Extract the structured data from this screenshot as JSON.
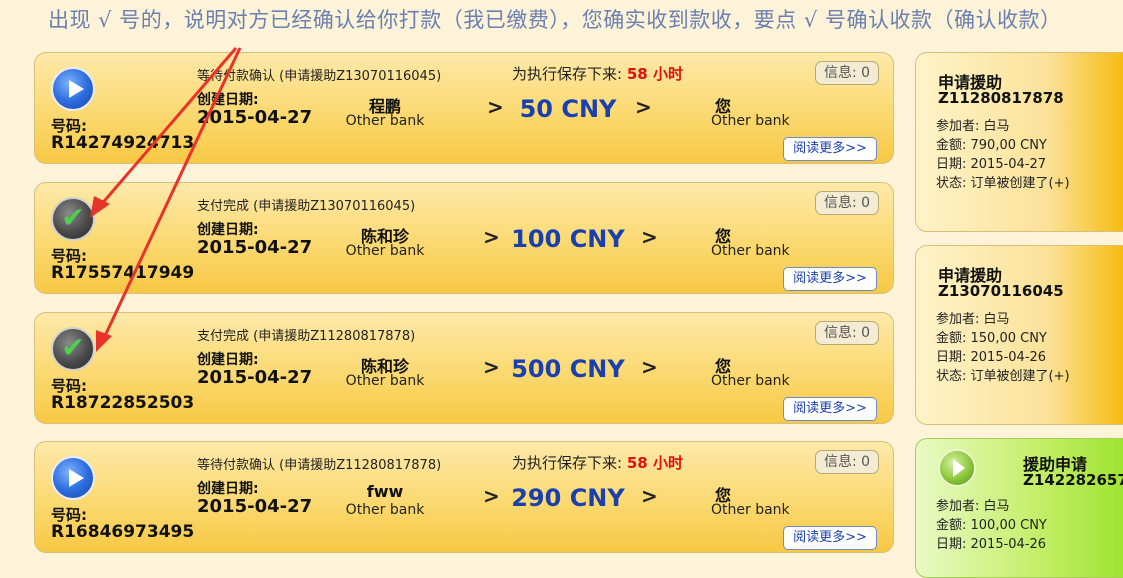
{
  "instruction": "出现 √ 号的，说明对方已经确认给你打款（我已缴费），您确实收到款收，要点 √ 号确认收款（确认收款）",
  "ui": {
    "ref_label": "号码:",
    "date_label": "创建日期:",
    "info_button": "信息: 0",
    "more_button": "阅读更多>>",
    "arrow": ">",
    "timer_label": "为执行保存下来:",
    "receiver_name": "您",
    "bank": "Other bank"
  },
  "orders": [
    {
      "icon": "play-icon",
      "status": "等待付款确认 (申请援助Z13070116045)",
      "timer": "58 小时",
      "ref": "R14274924713",
      "date": "2015-04-27",
      "sender": "程鹏",
      "amount": "50 CNY"
    },
    {
      "icon": "check-icon",
      "status": "支付完成 (申请援助Z13070116045)",
      "ref": "R17557417949",
      "date": "2015-04-27",
      "sender": "陈和珍",
      "amount": "100 CNY"
    },
    {
      "icon": "check-icon",
      "status": "支付完成 (申请援助Z11280817878)",
      "ref": "R18722852503",
      "date": "2015-04-27",
      "sender": "陈和珍",
      "amount": "500 CNY"
    },
    {
      "icon": "play-icon",
      "status": "等待付款确认 (申请援助Z11280817878)",
      "timer": "58 小时",
      "ref": "R16846973495",
      "date": "2015-04-27",
      "sender": "fww",
      "amount": "290 CNY"
    }
  ],
  "side": [
    {
      "title": "申请援助",
      "id": "Z11280817878",
      "participant": "参加者: 白马",
      "amount": "金额: 790,00 CNY",
      "date": "日期: 2015-04-27",
      "status": "状态: 订单被创建了(+)"
    },
    {
      "title": "申请援助",
      "id": "Z13070116045",
      "participant": "参加者: 白马",
      "amount": "金额: 150,00 CNY",
      "date": "日期: 2015-04-26",
      "status": "状态: 订单被创建了(+)"
    },
    {
      "title": "援助申请",
      "id": "Z142282657",
      "participant": "参加者: 白马",
      "amount": "金额: 100,00 CNY",
      "date": "日期: 2015-04-26"
    }
  ],
  "colors": {
    "annotation_arrow": "#e8332a",
    "amount_blue": "#1a3fae",
    "timer_red": "#e01010"
  }
}
